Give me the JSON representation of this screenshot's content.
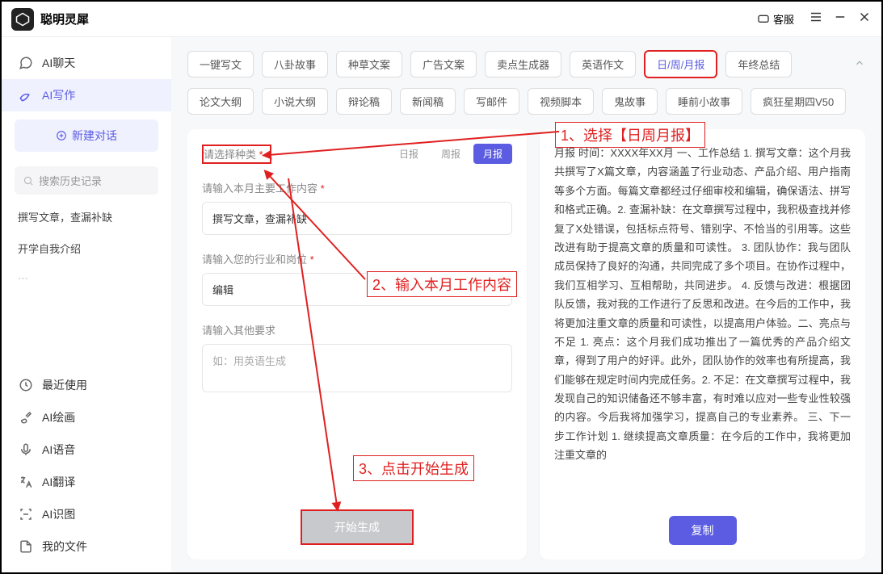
{
  "header": {
    "app_title": "聪明灵犀",
    "customer_service": "客服"
  },
  "sidebar": {
    "items": [
      {
        "label": "AI聊天",
        "icon": "chat"
      },
      {
        "label": "AI写作",
        "icon": "write",
        "active": true
      }
    ],
    "new_chat": "新建对话",
    "search_placeholder": "搜索历史记录",
    "history": [
      "撰写文章，查漏补缺",
      "开学自我介绍"
    ],
    "tools": [
      {
        "label": "最近使用",
        "icon": "clock"
      },
      {
        "label": "AI绘画",
        "icon": "brush"
      },
      {
        "label": "AI语音",
        "icon": "voice"
      },
      {
        "label": "AI翻译",
        "icon": "translate"
      },
      {
        "label": "AI识图",
        "icon": "scan"
      },
      {
        "label": "我的文件",
        "icon": "file"
      }
    ]
  },
  "categories": {
    "row1": [
      "一键写文",
      "八卦故事",
      "种草文案",
      "广告文案",
      "卖点生成器",
      "英语作文",
      "日/周/月报",
      "年终总结"
    ],
    "row2": [
      "论文大纲",
      "小说大纲",
      "辩论稿",
      "新闻稿",
      "写邮件",
      "视频脚本",
      "鬼故事",
      "睡前小故事",
      "疯狂星期四V50"
    ],
    "selected": "日/周/月报"
  },
  "form": {
    "type_label": "请选择种类",
    "periods": [
      "日报",
      "周报",
      "月报"
    ],
    "period_active": "月报",
    "content_label": "请输入本月主要工作内容",
    "content_value": "撰写文章，查漏补缺",
    "industry_label": "请输入您的行业和岗位",
    "industry_value": "编辑",
    "other_label": "请输入其他要求",
    "other_placeholder": "如：用英语生成",
    "generate_btn": "开始生成"
  },
  "result": {
    "text": "月报 时间：XXXX年XX月 一、工作总结 1. 撰写文章：这个月我共撰写了X篇文章，内容涵盖了行业动态、产品介绍、用户指南等多个方面。每篇文章都经过仔细审校和编辑，确保语法、拼写和格式正确。2. 查漏补缺：在文章撰写过程中，我积极查找并修复了X处错误，包括标点符号、错别字、不恰当的引用等。这些改进有助于提高文章的质量和可读性。 3. 团队协作：我与团队成员保持了良好的沟通，共同完成了多个项目。在协作过程中，我们互相学习、互相帮助，共同进步。 4. 反馈与改进：根据团队反馈，我对我的工作进行了反思和改进。在今后的工作中，我将更加注重文章的质量和可读性，以提高用户体验。二、亮点与不足 1. 亮点：这个月我们成功推出了一篇优秀的产品介绍文章，得到了用户的好评。此外，团队协作的效率也有所提高，我们能够在规定时间内完成任务。2. 不足：在文章撰写过程中，我发现自己的知识储备还不够丰富，有时难以应对一些专业性较强的内容。今后我将加强学习，提高自己的专业素养。 三、下一步工作计划 1. 继续提高文章质量：在今后的工作中，我将更加注重文章的",
    "copy_btn": "复制"
  },
  "annotations": {
    "step1": "1、选择【日周月报】",
    "step2": "2、输入本月工作内容",
    "step3": "3、点击开始生成"
  }
}
